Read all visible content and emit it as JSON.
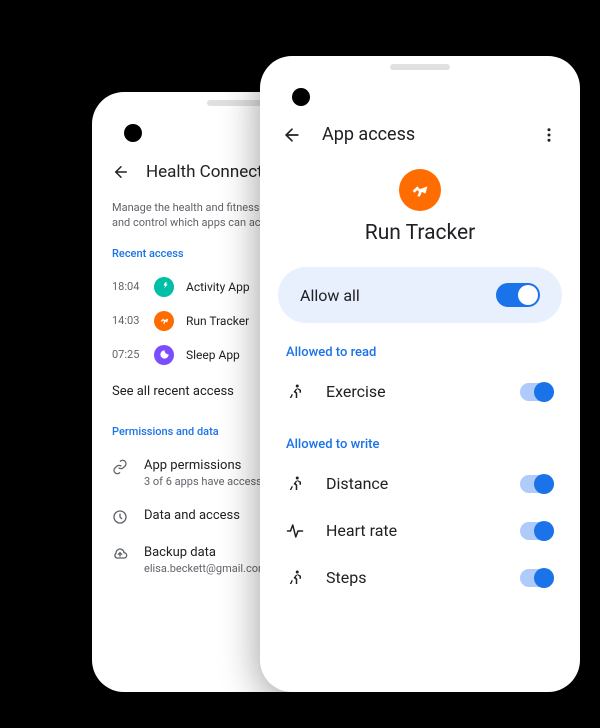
{
  "back": {
    "title": "Health Connect",
    "description": "Manage the health and fitness data on your phone, and control which apps can access",
    "recent_header": "Recent access",
    "recent": [
      {
        "time": "18:04",
        "name": "Activity App"
      },
      {
        "time": "14:03",
        "name": "Run Tracker"
      },
      {
        "time": "07:25",
        "name": "Sleep App"
      }
    ],
    "see_all": "See all recent access",
    "perm_header": "Permissions and data",
    "perms": [
      {
        "label": "App permissions",
        "sub": "3 of 6 apps have access"
      },
      {
        "label": "Data and access"
      },
      {
        "label": "Backup data",
        "sub": "elisa.beckett@gmail.com"
      }
    ]
  },
  "front": {
    "title": "App access",
    "app_name": "Run Tracker",
    "allow_all": "Allow all",
    "read_header": "Allowed to read",
    "read_perms": [
      {
        "label": "Exercise"
      }
    ],
    "write_header": "Allowed to write",
    "write_perms": [
      {
        "label": "Distance"
      },
      {
        "label": "Heart rate"
      },
      {
        "label": "Steps"
      }
    ]
  }
}
